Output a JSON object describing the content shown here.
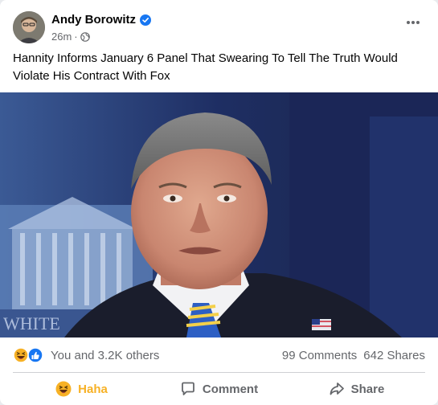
{
  "post": {
    "author": "Andy Borowitz",
    "timestamp": "26m",
    "separator": "·",
    "privacy_icon": "globe-icon",
    "text": "Hannity Informs January 6 Panel That Swearing To Tell The Truth Would Violate His Contract With Fox"
  },
  "reactions": {
    "icons": [
      "haha-emoji-icon",
      "like-icon"
    ],
    "summary": "You and 3.2K others",
    "comments": "99 Comments",
    "shares": "642 Shares"
  },
  "actions": {
    "react_label": "Haha",
    "comment_label": "Comment",
    "share_label": "Share"
  },
  "colors": {
    "haha": "#f7b125",
    "like": "#1877f2",
    "verified": "#1877f2",
    "muted": "#65676b"
  }
}
